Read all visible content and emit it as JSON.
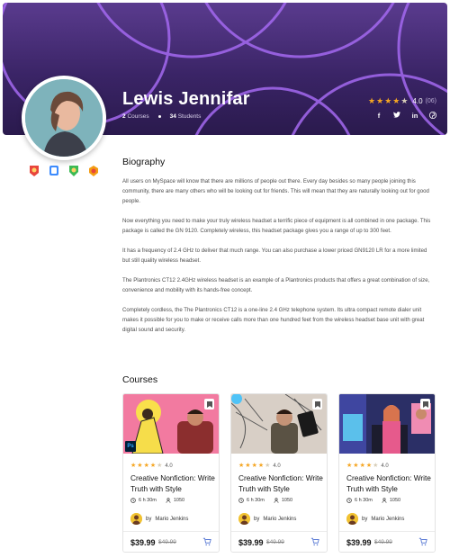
{
  "profile": {
    "name": "Lewis Jennifar",
    "courses_count": "2",
    "courses_label": "Courses",
    "students_count": "34",
    "students_label": "Students",
    "rating": "4.0",
    "rating_count": "(06)",
    "rating_stars": 4
  },
  "socials": [
    "f",
    "t",
    "in",
    "p"
  ],
  "badges": [
    "badge-red",
    "badge-blue",
    "badge-green",
    "badge-orange"
  ],
  "biography": {
    "title": "Biography",
    "paragraphs": [
      "All users on MySpace will know that there are millions of people out there. Every day besides so many people joining this community, there are many others who will be looking out for friends. This will mean that they are naturally looking out for good people.",
      "Now everything you need to make your truly wireless headset a terrific piece of equipment is all combined in one package. This package is called the GN 9120. Completely wireless, this headset package gives you a range of up to 300 feet.",
      "It has a frequency of 2.4 GHz to deliver that much range. You can also purchase a lower priced GN9120 LR for a more limited but still quality wireless headset.",
      "The Plantronics CT12 2.4GHz wireless headset is an example of a Plantronics products that offers a great combination of size, convenience and mobility with its hands-free concept.",
      "Completely cordless, the The Plantronics CT12 is a one-line 2.4 GHz telephone system. Its ultra compact remote dialer unit makes it possible for you to make or receive calls more than one hundred feet from the wireless headset base unit with great digital sound and security."
    ]
  },
  "courses": {
    "title": "Courses",
    "items": [
      {
        "rating": "4.0",
        "title": "Creative Nonfiction: Write Truth with Style",
        "duration": "6 h 30m",
        "students": "1050",
        "author_prefix": "by",
        "author": "Mario Jenkins",
        "price": "$39.99",
        "old_price": "$49.99",
        "badge": "Ps"
      },
      {
        "rating": "4.0",
        "title": "Creative Nonfiction: Write Truth with Style",
        "duration": "6 h 30m",
        "students": "1050",
        "author_prefix": "by",
        "author": "Mario Jenkins",
        "price": "$39.99",
        "old_price": "$49.99",
        "badge": ""
      },
      {
        "rating": "4.0",
        "title": "Creative Nonfiction: Write Truth with Style",
        "duration": "6 h 30m",
        "students": "1050",
        "author_prefix": "by",
        "author": "Mario Jenkins",
        "price": "$39.99",
        "old_price": "$49.99",
        "badge": ""
      }
    ]
  },
  "colors": {
    "banner": "#3a2466",
    "accent": "#a469f0",
    "star": "#f5a623",
    "cart": "#5b7bd5"
  }
}
